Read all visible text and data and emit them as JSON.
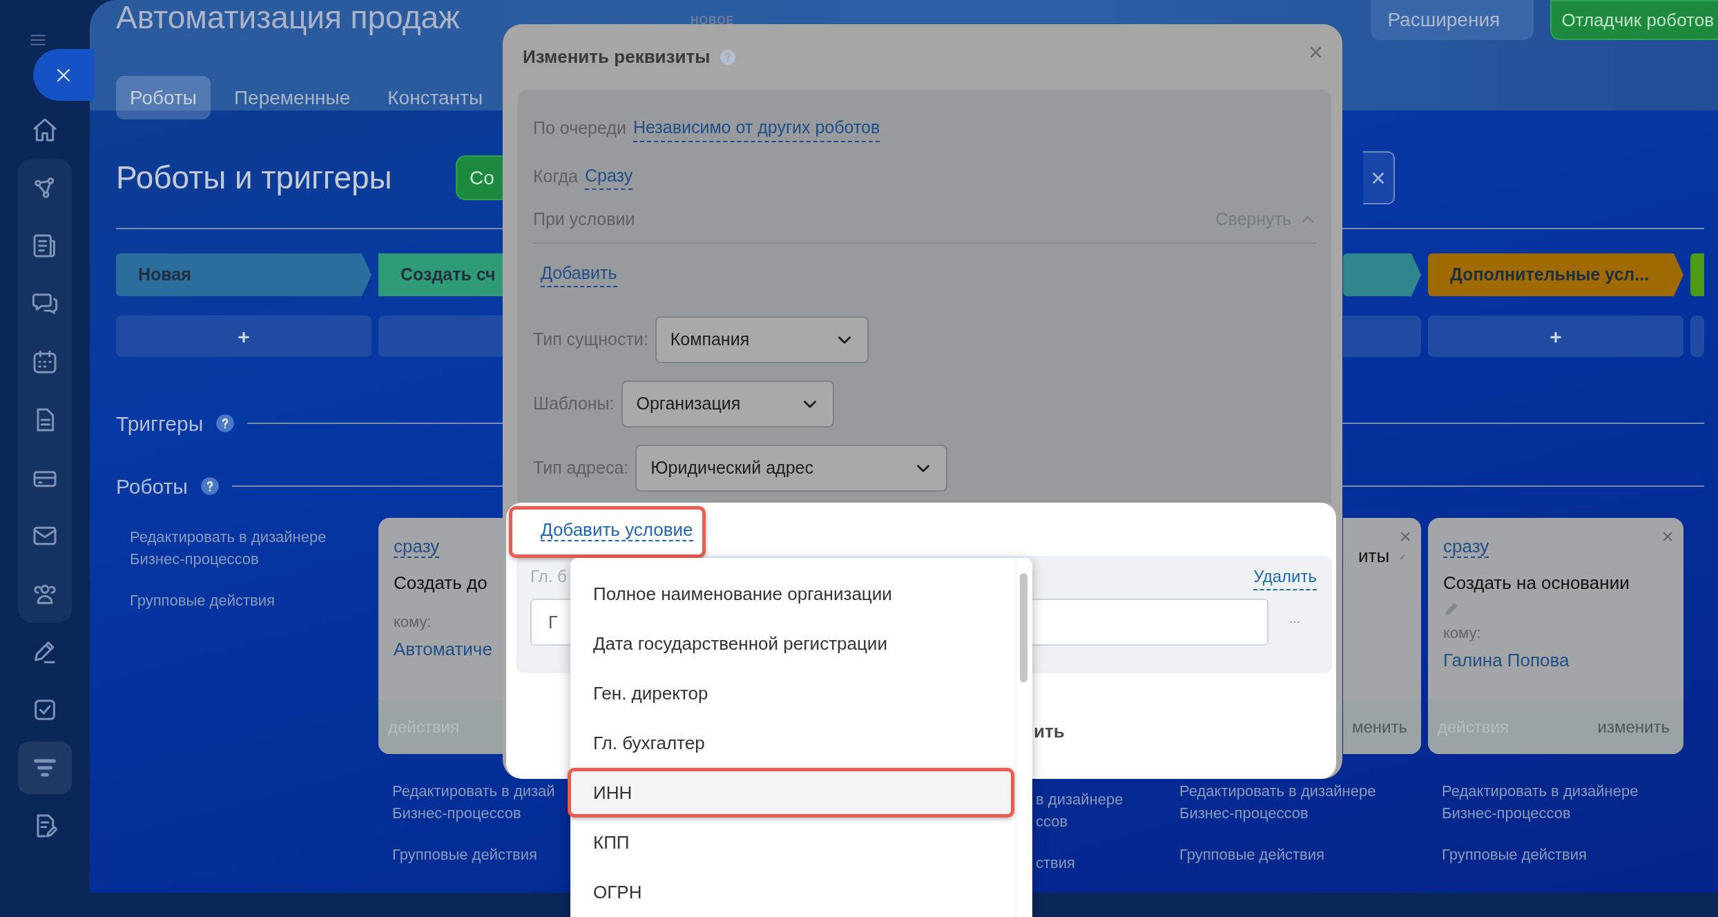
{
  "sidebar": {
    "items": [
      {
        "selected": false
      },
      {
        "selected": false
      },
      {
        "selected": false
      },
      {
        "selected": false
      },
      {
        "selected": false
      },
      {
        "selected": false
      },
      {
        "selected": false
      },
      {
        "selected": false
      },
      {
        "selected": false
      },
      {
        "selected": false
      },
      {
        "selected": false
      },
      {
        "selected": true
      },
      {
        "selected": false
      }
    ]
  },
  "header": {
    "title": "Автоматизация продаж",
    "badge": "НОВОЕ",
    "buttons": [
      {
        "label": "Расширения",
        "kind": "dropdown"
      },
      {
        "label": "Отладчик роботов",
        "kind": "primary"
      }
    ],
    "tabs": [
      {
        "label": "Роботы",
        "selected": true
      },
      {
        "label": "Переменные",
        "selected": false
      },
      {
        "label": "Константы",
        "selected": false
      }
    ]
  },
  "page": {
    "heading": "Роботы и триггеры",
    "create_button": "Со"
  },
  "stages": [
    {
      "label": "Новая",
      "color": "#2b6d9d",
      "add": "+"
    },
    {
      "label": "Создать сч",
      "color": "#2f9b77"
    },
    {
      "color": "#2f868c"
    },
    {
      "label": "Дополнительные усл...",
      "color": "#a06a02",
      "add": "+"
    },
    {
      "color": "#4b9a14"
    }
  ],
  "sections": {
    "triggers": "Триггеры",
    "robots": "Роботы"
  },
  "robot_columns": [
    {
      "designer_link": [
        "Редактировать в дизайнере",
        "Бизнес-процессов"
      ],
      "group_actions": "Групповые действия"
    },
    {
      "card": {
        "timing": "сразу",
        "title": "Создать до",
        "to_label": "кому:",
        "to": "Автоматиче",
        "footer_left": "действия"
      },
      "designer_link": [
        "Редактировать в дизай",
        "Бизнес-процессов"
      ],
      "group_actions": "Групповые действия"
    },
    {
      "designer_link": [
        "в дизайнере",
        "ссов"
      ],
      "group_actions": "ствия"
    },
    {
      "card": {
        "close": "×",
        "title": "иты",
        "edit_icon": true,
        "footer_right": "менить"
      },
      "designer_link": [
        "Редактировать в дизайнере",
        "Бизнес-процессов"
      ],
      "group_actions": "Групповые действия"
    },
    {
      "card": {
        "close": "×",
        "timing": "сразу",
        "title": "Создать на основании",
        "edit_icon": true,
        "to_label": "кому:",
        "to": "Галина Попова",
        "footer_left": "действия",
        "footer_right": "изменить"
      },
      "designer_link": [
        "Редактировать в дизайнере",
        "Бизнес-процессов"
      ],
      "group_actions": "Групповые действия"
    }
  ],
  "dialog": {
    "title": "Изменить реквизиты",
    "close": "×",
    "fields": [
      {
        "label": "По очереди",
        "value": "Независимо от других роботов"
      },
      {
        "label": "Когда",
        "value": "Сразу"
      }
    ],
    "condition": {
      "label": "При условии",
      "collapse": "Свернуть",
      "add": "Добавить"
    },
    "selects": [
      {
        "label": "Тип сущности:",
        "value": "Компания"
      },
      {
        "label": "Шаблоны:",
        "value": "Организация"
      },
      {
        "label": "Тип адреса:",
        "value": "Юридический адрес"
      }
    ],
    "add_condition": {
      "label": "Добавить условие",
      "highlighted": true
    },
    "condition_row": {
      "label": "Гл. б",
      "delete": "Удалить",
      "value": "Г"
    },
    "footer_button": "ить"
  },
  "dropdown": {
    "items": [
      {
        "label": "Полное наименование организации",
        "selected": false
      },
      {
        "label": "Дата государственной регистрации",
        "selected": false
      },
      {
        "label": "Ген. директор",
        "selected": false
      },
      {
        "label": "Гл. бухгалтер",
        "selected": false
      },
      {
        "label": "ИНН",
        "selected": true
      },
      {
        "label": "КПП",
        "selected": false
      },
      {
        "label": "ОГРН",
        "selected": false
      }
    ]
  }
}
